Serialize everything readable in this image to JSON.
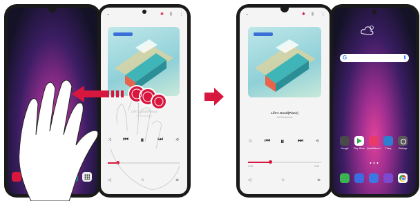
{
  "left_illustration": {
    "right_screen": {
      "song_title": "Life's Good(Piano)",
      "artist": "LG Electronics"
    }
  },
  "right_illustration": {
    "left_screen": {
      "song_title": "Life's Good(Piano)",
      "artist": "LG Electronics",
      "time_elapsed": "0:39",
      "time_total": "2:55"
    },
    "right_screen": {
      "apps_row": [
        {
          "label": "Google",
          "color": "#4a4a4a"
        },
        {
          "label": "Play Store",
          "color": "#ffffff"
        },
        {
          "label": "QuickMemo+",
          "color": "#e83a6b"
        },
        {
          "label": "Thinq",
          "color": "#2f7fd1"
        },
        {
          "label": "Settings",
          "color": "#5a5a5a"
        }
      ],
      "dock": [
        {
          "name": "phone-app-icon",
          "color": "#3cb551"
        },
        {
          "name": "messages-app-icon",
          "color": "#3d6be0"
        },
        {
          "name": "camera-app-icon",
          "color": "#3b78e0"
        },
        {
          "name": "gallery-app-icon",
          "color": "#7a4bd1"
        },
        {
          "name": "chrome-app-icon",
          "color": "#ffffff"
        }
      ]
    }
  },
  "colors": {
    "accent_red": "#d8173f",
    "device_frame": "#1a1a1a"
  }
}
